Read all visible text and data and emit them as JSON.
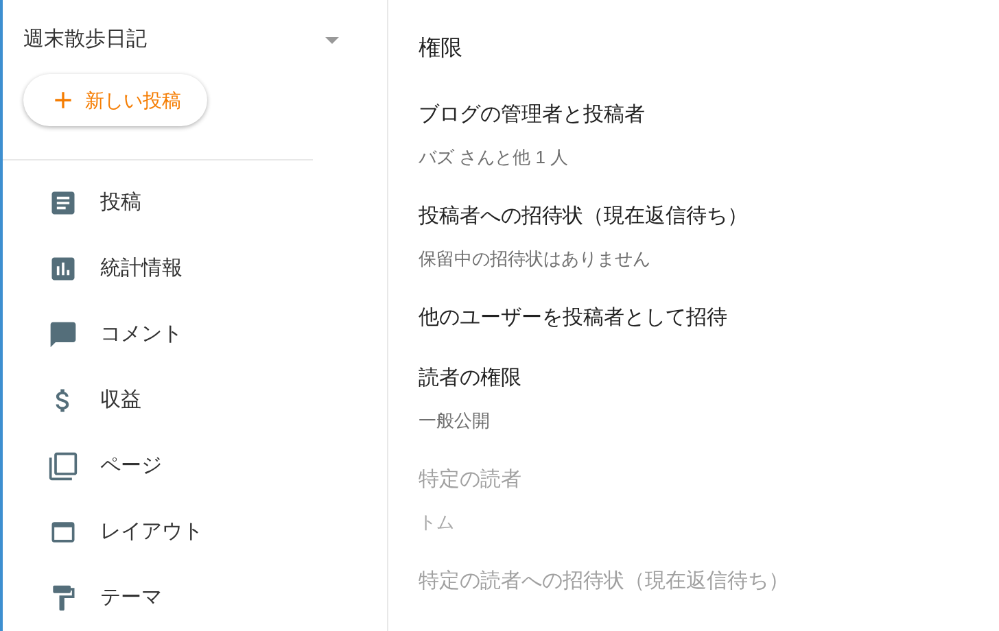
{
  "sidebar": {
    "blog_title": "週末散歩日記",
    "new_post_button": "新しい投稿",
    "items": [
      {
        "kind": "posts",
        "label": "投稿"
      },
      {
        "kind": "stats",
        "label": "統計情報"
      },
      {
        "kind": "comments",
        "label": "コメント"
      },
      {
        "kind": "earnings",
        "label": "収益"
      },
      {
        "kind": "pages",
        "label": "ページ"
      },
      {
        "kind": "layout",
        "label": "レイアウト"
      },
      {
        "kind": "theme",
        "label": "テーマ"
      }
    ]
  },
  "settings": {
    "heading": "権限",
    "items": [
      {
        "title": "ブログの管理者と投稿者",
        "value": "バズ さんと他 1 人",
        "disabled": false
      },
      {
        "title": "投稿者への招待状（現在返信待ち）",
        "value": "保留中の招待状はありません",
        "disabled": false
      },
      {
        "title": "他のユーザーを投稿者として招待",
        "disabled": false
      },
      {
        "title": "読者の権限",
        "value": "一般公開",
        "disabled": false
      },
      {
        "title": "特定の読者",
        "value": "トム",
        "disabled": true
      },
      {
        "title": "特定の読者への招待状（現在返信待ち）",
        "disabled": true
      }
    ]
  }
}
